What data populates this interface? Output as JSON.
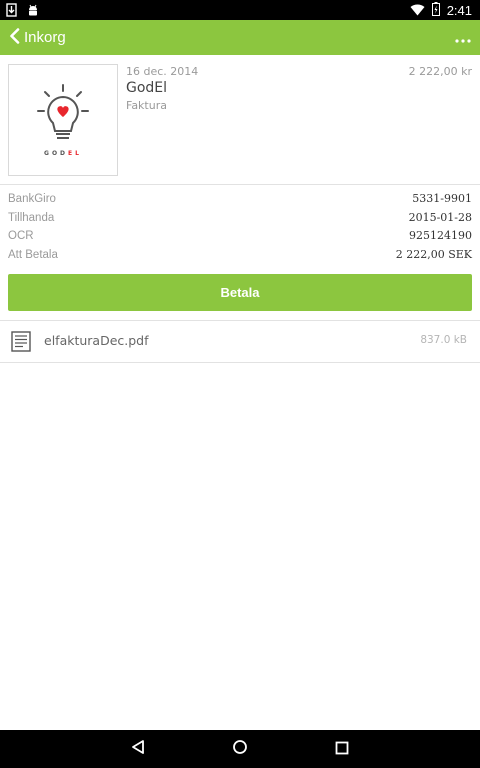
{
  "status_bar": {
    "time": "2:41",
    "icons": [
      "download-icon",
      "android-icon",
      "wifi-icon",
      "battery-charging-icon"
    ]
  },
  "app_bar": {
    "back_label": "Inkorg",
    "overflow_icon": "overflow-menu-icon",
    "color": "#8cc63f"
  },
  "message": {
    "date": "16 dec. 2014",
    "amount": "2 222,00 kr",
    "sender": "GodEl",
    "type": "Faktura",
    "logo": {
      "text_dark": "GOD",
      "text_accent": "EL",
      "accent_color": "#e8262d"
    }
  },
  "details": {
    "rows": [
      {
        "label": "BankGiro",
        "value": "5331-9901"
      },
      {
        "label": "Tillhanda",
        "value": "2015-01-28"
      },
      {
        "label": "OCR",
        "value": "925124190"
      },
      {
        "label": "Att Betala",
        "value": "2 222,00 SEK"
      }
    ]
  },
  "pay_button": {
    "label": "Betala"
  },
  "attachment": {
    "name": "elfakturaDec.pdf",
    "size": "837.0 kB"
  }
}
